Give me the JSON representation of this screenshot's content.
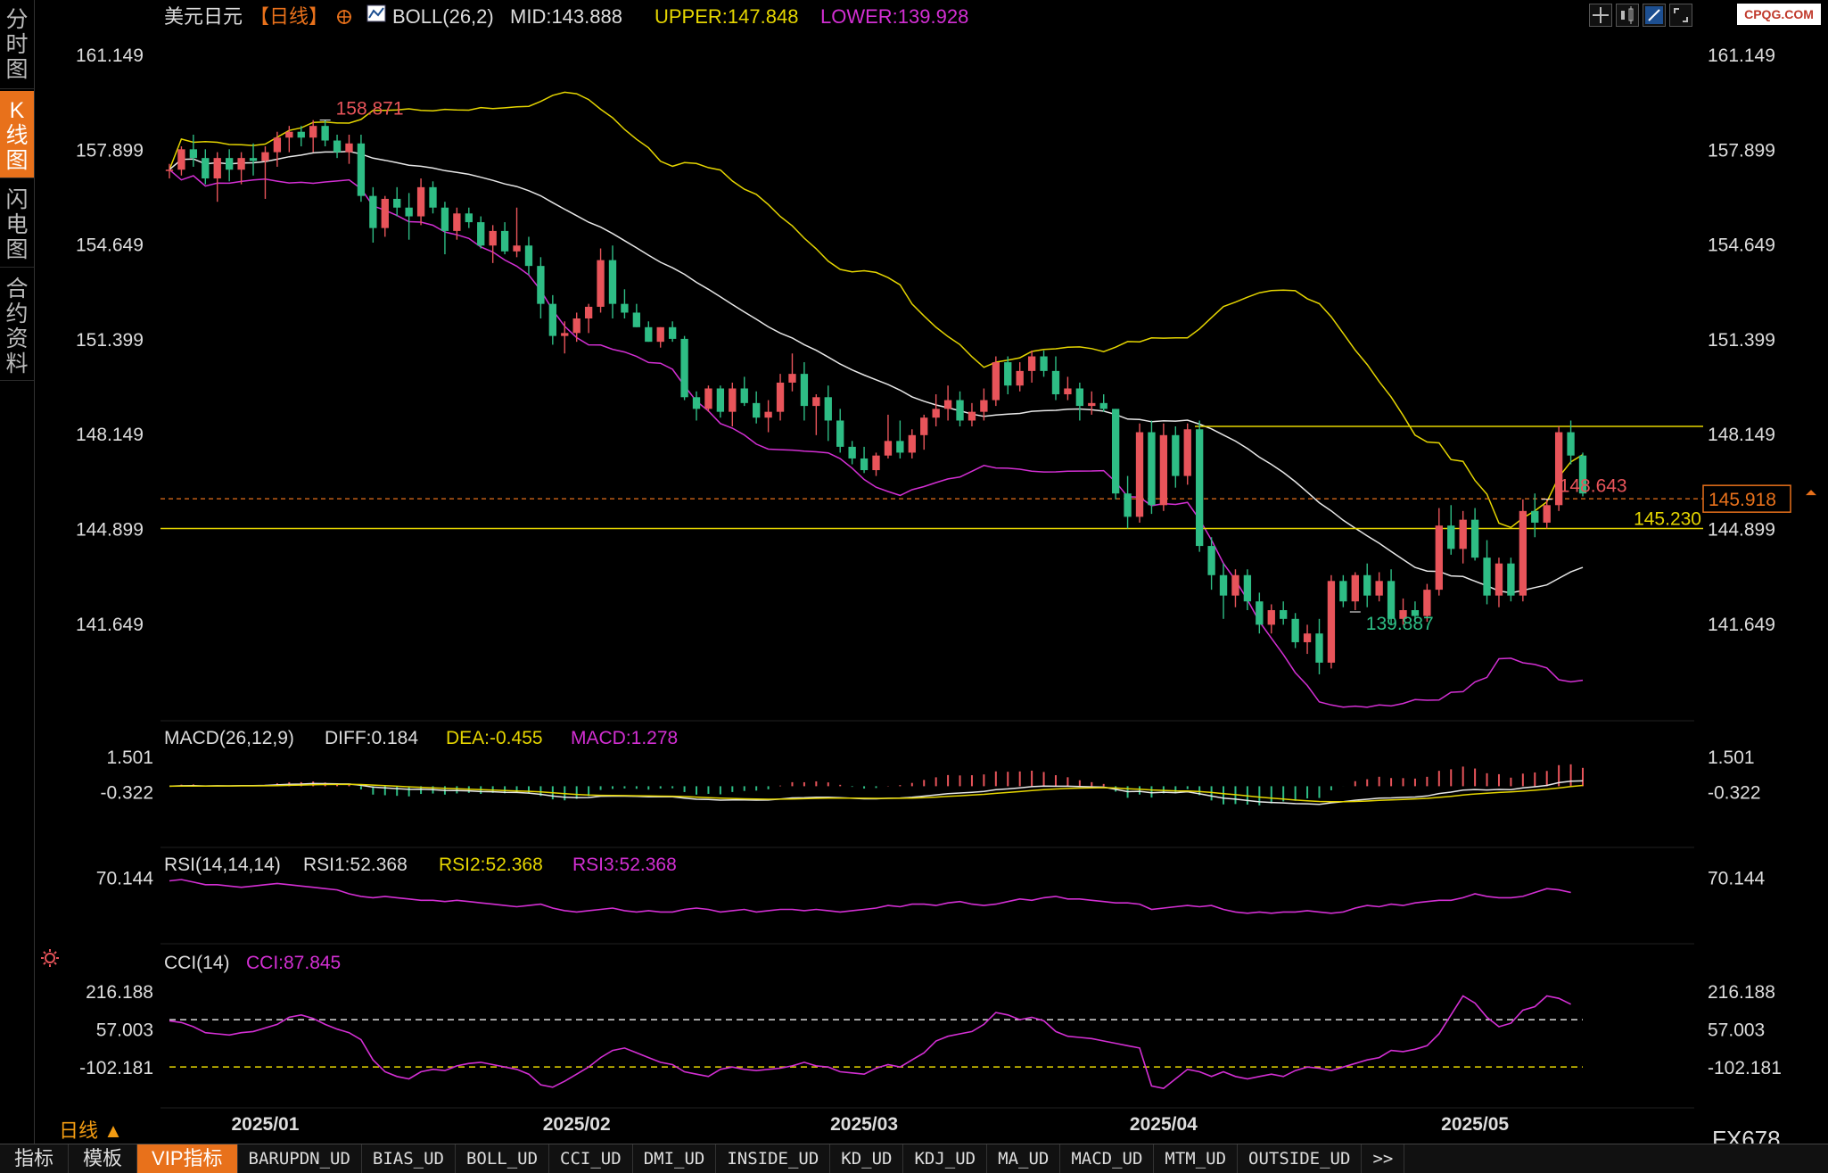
{
  "side_tabs": [
    {
      "label": "分时图",
      "active": false
    },
    {
      "label": "K线图",
      "active": true
    },
    {
      "label": "闪电图",
      "active": false
    },
    {
      "label": "合约资料",
      "active": false
    }
  ],
  "header": {
    "instrument": "美元日元",
    "period_tag": "【日线】",
    "boll_label": "BOLL(26,2)",
    "mid": "MID:143.888",
    "upper": "UPPER:147.848",
    "lower": "LOWER:139.928"
  },
  "logo_text": "CPQG.COM",
  "period_label": "日线 ▲",
  "symbol_code": "FX678",
  "toolbar": [
    "指标",
    "模板",
    "VIP指标",
    "BARUPDN_UD",
    "BIAS_UD",
    "BOLL_UD",
    "CCI_UD",
    "DMI_UD",
    "INSIDE_UD",
    "KD_UD",
    "KDJ_UD",
    "MA_UD",
    "MACD_UD",
    "MTM_UD",
    "OUTSIDE_UD",
    ">>"
  ],
  "toolbar_active": "VIP指标",
  "colors": {
    "up": "#e8545a",
    "down": "#2ebd85",
    "yellow": "#e5d500",
    "magenta": "#d32fd3",
    "white": "#e8e8e8",
    "orange": "#e8711b"
  },
  "chart_data": [
    {
      "id": "price",
      "type": "candlestick",
      "ylim": [
        138.4,
        162.1
      ],
      "y_ticks": [
        "161.149",
        "157.899",
        "154.649",
        "151.399",
        "148.149",
        "144.899",
        "141.649"
      ],
      "x_ticks": [
        "2025/01",
        "2025/02",
        "2025/03",
        "2025/04",
        "2025/05"
      ],
      "x_tick_index": [
        8,
        34,
        58,
        83,
        109
      ],
      "labels": {
        "high": "158.871",
        "low": "139.887",
        "recent_high": "148.643",
        "level": "145.230",
        "current": "145.918"
      },
      "high_index": 13,
      "low_index": 99,
      "recent_high_index": 115,
      "level_value": 145.23,
      "current_value": 145.918,
      "support_value": 144.9,
      "resistance_value": 148.4,
      "candles": [
        [
          157.2,
          157.4,
          156.9,
          157.2
        ],
        [
          157.2,
          158.0,
          157.0,
          157.9
        ],
        [
          157.9,
          158.4,
          157.3,
          157.6
        ],
        [
          157.6,
          157.9,
          156.7,
          156.9
        ],
        [
          156.9,
          157.8,
          156.1,
          157.6
        ],
        [
          157.6,
          157.9,
          156.8,
          157.2
        ],
        [
          157.2,
          157.8,
          156.7,
          157.6
        ],
        [
          157.6,
          158.1,
          157.0,
          157.5
        ],
        [
          157.5,
          158.0,
          156.2,
          157.8
        ],
        [
          157.8,
          158.5,
          157.3,
          158.3
        ],
        [
          158.3,
          158.7,
          157.8,
          158.5
        ],
        [
          158.5,
          158.7,
          158.0,
          158.3
        ],
        [
          158.3,
          158.9,
          157.8,
          158.7
        ],
        [
          158.7,
          158.9,
          158.0,
          158.2
        ],
        [
          158.2,
          158.4,
          157.6,
          157.8
        ],
        [
          157.8,
          158.4,
          157.4,
          158.1
        ],
        [
          158.1,
          158.4,
          156.1,
          156.3
        ],
        [
          156.3,
          156.6,
          154.7,
          155.2
        ],
        [
          155.2,
          156.3,
          154.9,
          156.2
        ],
        [
          156.2,
          156.6,
          155.6,
          155.9
        ],
        [
          155.9,
          156.4,
          154.8,
          155.6
        ],
        [
          155.6,
          156.9,
          155.3,
          156.6
        ],
        [
          156.6,
          156.8,
          155.7,
          155.9
        ],
        [
          155.9,
          156.1,
          154.3,
          155.1
        ],
        [
          155.1,
          155.9,
          154.8,
          155.7
        ],
        [
          155.7,
          155.9,
          155.2,
          155.4
        ],
        [
          155.4,
          155.6,
          154.5,
          154.6
        ],
        [
          154.6,
          155.3,
          154.0,
          155.1
        ],
        [
          155.1,
          155.4,
          154.3,
          154.4
        ],
        [
          154.4,
          155.9,
          154.2,
          154.6
        ],
        [
          154.6,
          154.9,
          153.6,
          153.9
        ],
        [
          153.9,
          154.2,
          152.1,
          152.6
        ],
        [
          152.6,
          152.9,
          151.2,
          151.5
        ],
        [
          151.5,
          152.0,
          150.9,
          151.6
        ],
        [
          151.6,
          152.3,
          151.3,
          152.1
        ],
        [
          152.1,
          152.6,
          151.6,
          152.5
        ],
        [
          152.5,
          154.5,
          152.3,
          154.1
        ],
        [
          154.1,
          154.6,
          152.1,
          152.6
        ],
        [
          152.6,
          153.1,
          152.1,
          152.3
        ],
        [
          152.3,
          152.6,
          151.8,
          151.8
        ],
        [
          151.8,
          152.0,
          151.3,
          151.3
        ],
        [
          151.3,
          151.8,
          151.1,
          151.8
        ],
        [
          151.8,
          152.0,
          151.3,
          151.4
        ],
        [
          151.4,
          151.5,
          149.3,
          149.4
        ],
        [
          149.4,
          149.6,
          148.6,
          149.0
        ],
        [
          149.0,
          149.8,
          148.9,
          149.7
        ],
        [
          149.7,
          149.8,
          148.7,
          148.9
        ],
        [
          148.9,
          149.9,
          148.4,
          149.7
        ],
        [
          149.7,
          150.1,
          149.1,
          149.2
        ],
        [
          149.2,
          149.6,
          148.5,
          148.7
        ],
        [
          148.7,
          149.3,
          148.2,
          148.9
        ],
        [
          148.9,
          150.2,
          148.6,
          149.9
        ],
        [
          149.9,
          150.9,
          149.6,
          150.2
        ],
        [
          150.2,
          150.6,
          148.6,
          149.1
        ],
        [
          149.1,
          149.5,
          148.1,
          149.4
        ],
        [
          149.4,
          149.8,
          147.9,
          148.6
        ],
        [
          148.6,
          149.0,
          147.5,
          147.7
        ],
        [
          147.7,
          147.9,
          147.1,
          147.3
        ],
        [
          147.3,
          147.7,
          146.8,
          146.9
        ],
        [
          146.9,
          147.5,
          146.7,
          147.4
        ],
        [
          147.4,
          148.8,
          147.3,
          147.9
        ],
        [
          147.9,
          148.6,
          147.3,
          147.5
        ],
        [
          147.5,
          148.3,
          147.3,
          148.1
        ],
        [
          148.1,
          148.8,
          147.6,
          148.7
        ],
        [
          148.7,
          149.5,
          148.4,
          149.0
        ],
        [
          149.0,
          149.8,
          148.6,
          149.3
        ],
        [
          149.3,
          149.6,
          148.4,
          148.6
        ],
        [
          148.6,
          149.2,
          148.4,
          148.9
        ],
        [
          148.9,
          149.7,
          148.6,
          149.3
        ],
        [
          149.3,
          150.8,
          149.1,
          150.6
        ],
        [
          150.6,
          150.8,
          149.5,
          149.8
        ],
        [
          149.8,
          150.6,
          149.6,
          150.3
        ],
        [
          150.3,
          151.0,
          149.9,
          150.8
        ],
        [
          150.8,
          151.0,
          150.1,
          150.3
        ],
        [
          150.3,
          150.8,
          149.3,
          149.5
        ],
        [
          149.5,
          150.1,
          149.3,
          149.7
        ],
        [
          149.7,
          149.9,
          148.6,
          149.1
        ],
        [
          149.1,
          149.6,
          148.8,
          149.2
        ],
        [
          149.2,
          149.5,
          148.9,
          149.0
        ],
        [
          149.0,
          149.0,
          145.9,
          146.1
        ],
        [
          146.1,
          146.7,
          144.9,
          145.3
        ],
        [
          145.3,
          148.5,
          145.1,
          148.2
        ],
        [
          148.2,
          148.6,
          145.4,
          145.7
        ],
        [
          145.7,
          148.5,
          145.5,
          148.1
        ],
        [
          148.1,
          148.4,
          146.3,
          146.7
        ],
        [
          146.7,
          148.5,
          146.4,
          148.3
        ],
        [
          148.3,
          148.6,
          144.1,
          144.3
        ],
        [
          144.3,
          144.6,
          142.8,
          143.3
        ],
        [
          143.3,
          143.7,
          141.8,
          142.6
        ],
        [
          142.6,
          143.5,
          142.2,
          143.3
        ],
        [
          143.3,
          143.5,
          142.1,
          142.4
        ],
        [
          142.4,
          142.7,
          141.3,
          141.6
        ],
        [
          141.6,
          142.3,
          141.3,
          142.1
        ],
        [
          142.1,
          142.4,
          141.6,
          141.8
        ],
        [
          141.8,
          142.0,
          140.8,
          141.0
        ],
        [
          141.0,
          141.6,
          140.6,
          141.3
        ],
        [
          141.3,
          141.8,
          139.9,
          140.3
        ],
        [
          140.3,
          143.3,
          140.1,
          143.1
        ],
        [
          143.1,
          143.3,
          142.2,
          142.4
        ],
        [
          142.4,
          143.4,
          142.1,
          143.3
        ],
        [
          143.3,
          143.7,
          142.2,
          142.6
        ],
        [
          142.6,
          143.4,
          142.4,
          143.1
        ],
        [
          143.1,
          143.5,
          141.6,
          141.8
        ],
        [
          141.8,
          142.5,
          141.6,
          142.1
        ],
        [
          142.1,
          142.4,
          141.7,
          141.9
        ],
        [
          141.9,
          143.0,
          141.7,
          142.8
        ],
        [
          142.8,
          145.6,
          142.6,
          145.0
        ],
        [
          145.0,
          145.7,
          144.0,
          144.2
        ],
        [
          144.2,
          145.5,
          143.7,
          145.2
        ],
        [
          145.2,
          145.6,
          143.8,
          143.9
        ],
        [
          143.9,
          144.5,
          142.3,
          142.6
        ],
        [
          142.6,
          143.9,
          142.2,
          143.7
        ],
        [
          143.7,
          143.9,
          142.4,
          142.6
        ],
        [
          142.6,
          145.9,
          142.4,
          145.5
        ],
        [
          145.5,
          146.1,
          144.6,
          145.1
        ],
        [
          145.1,
          145.9,
          144.9,
          145.7
        ],
        [
          145.7,
          148.4,
          145.5,
          148.2
        ],
        [
          148.2,
          148.6,
          147.1,
          147.4
        ],
        [
          147.4,
          147.5,
          146.0,
          146.1
        ]
      ]
    },
    {
      "id": "macd",
      "type": "line",
      "name": "MACD(26,12,9)",
      "legend": [
        "DIFF:0.184",
        "DEA:-0.455",
        "MACD:1.278"
      ],
      "y_ticks": [
        "1.501",
        "-0.322"
      ],
      "ylim": [
        -2.7,
        2.0
      ]
    },
    {
      "id": "rsi",
      "type": "line",
      "name": "RSI(14,14,14)",
      "legend": [
        "RSI1:52.368",
        "RSI2:52.368",
        "RSI3:52.368"
      ],
      "y_ticks": [
        "70.144"
      ],
      "ylim": [
        25,
        80
      ],
      "values": [
        68,
        69,
        67,
        65,
        65,
        64,
        63,
        64,
        65,
        66,
        65,
        64,
        63,
        62,
        61,
        58,
        56,
        55,
        56,
        55,
        54,
        53,
        53,
        52,
        53,
        52,
        51,
        50,
        49,
        48,
        49,
        50,
        47,
        45,
        44,
        45,
        46,
        47,
        45,
        44,
        45,
        44,
        44,
        46,
        47,
        46,
        44,
        45,
        46,
        44,
        45,
        46,
        46,
        45,
        46,
        45,
        44,
        45,
        46,
        47,
        49,
        48,
        50,
        50,
        49,
        51,
        52,
        50,
        49,
        50,
        52,
        54,
        53,
        55,
        56,
        54,
        54,
        53,
        52,
        51,
        51,
        50,
        46,
        47,
        48,
        49,
        48,
        49,
        46,
        44,
        43,
        44,
        43,
        44,
        44,
        45,
        44,
        43,
        44,
        47,
        49,
        48,
        50,
        49,
        51,
        52,
        53,
        53,
        55,
        58,
        56,
        55,
        55,
        56,
        59,
        62,
        61,
        59
      ]
    },
    {
      "id": "cci",
      "type": "line",
      "name": "CCI(14)",
      "legend": [
        "CCI:87.845"
      ],
      "y_ticks": [
        "216.188",
        "57.003",
        "-102.181"
      ],
      "ylim": [
        -265,
        330
      ],
      "ref_levels": [
        100,
        -100
      ],
      "values": [
        95,
        88,
        70,
        45,
        40,
        35,
        45,
        50,
        65,
        80,
        110,
        120,
        105,
        80,
        60,
        45,
        15,
        -70,
        -120,
        -140,
        -150,
        -120,
        -110,
        -115,
        -95,
        -85,
        -80,
        -90,
        -100,
        -110,
        -130,
        -175,
        -185,
        -160,
        -130,
        -100,
        -60,
        -30,
        -20,
        -40,
        -60,
        -80,
        -90,
        -120,
        -130,
        -140,
        -110,
        -100,
        -110,
        -115,
        -110,
        -105,
        -95,
        -80,
        -95,
        -100,
        -120,
        -125,
        -130,
        -105,
        -90,
        -100,
        -70,
        -40,
        10,
        30,
        40,
        50,
        80,
        130,
        120,
        100,
        110,
        95,
        50,
        30,
        25,
        20,
        10,
        0,
        -10,
        -20,
        -180,
        -190,
        -150,
        -110,
        -120,
        -140,
        -120,
        -140,
        -150,
        -140,
        -130,
        -140,
        -115,
        -100,
        -105,
        -115,
        -100,
        -85,
        -70,
        -60,
        -30,
        -35,
        -25,
        -10,
        40,
        120,
        200,
        170,
        110,
        70,
        85,
        140,
        155,
        200,
        190,
        165
      ]
    }
  ]
}
